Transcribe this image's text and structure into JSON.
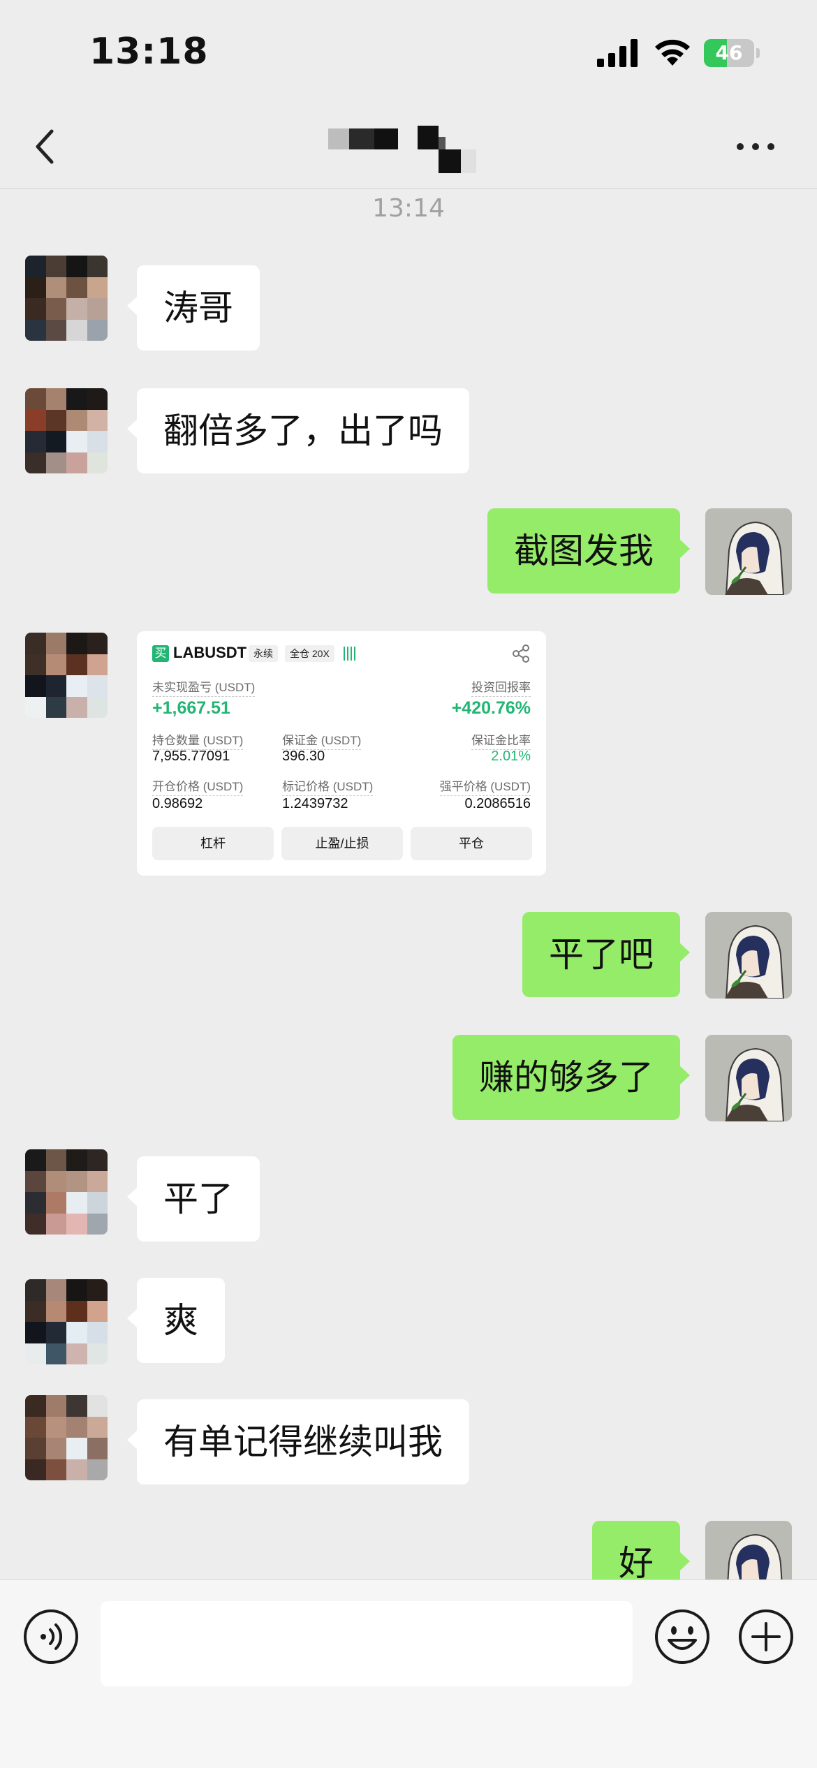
{
  "status_bar": {
    "time": "13:18",
    "battery_level": "46",
    "battery_fraction": 0.46,
    "battery_color": "#34c759"
  },
  "nav": {
    "back_icon": "chevron-left-icon",
    "more_icon": "ellipsis-icon"
  },
  "conversation": {
    "timestamp": "13:14",
    "messages": [
      {
        "from": "contact",
        "text": "涛哥"
      },
      {
        "from": "contact",
        "text": "翻倍多了，出了吗"
      },
      {
        "from": "me",
        "text": "截图发我"
      },
      {
        "from": "contact",
        "type": "image",
        "text": "trading-screenshot"
      },
      {
        "from": "me",
        "text": "平了吧"
      },
      {
        "from": "me",
        "text": "赚的够多了"
      },
      {
        "from": "contact",
        "text": "平了"
      },
      {
        "from": "contact",
        "text": "爽"
      },
      {
        "from": "contact",
        "text": "有单记得继续叫我"
      },
      {
        "from": "me",
        "text": "好"
      }
    ]
  },
  "trade_card": {
    "side_tag": "买",
    "symbol": "LABUSDT",
    "contract_type": "永续",
    "margin_mode": "全仓 20X",
    "unrealized_pnl_label": "未实现盈亏 (USDT)",
    "unrealized_pnl": "+1,667.51",
    "roi_label": "投资回报率",
    "roi": "+420.76%",
    "position_size_label": "持仓数量 (USDT)",
    "position_size": "7,955.77091",
    "margin_label": "保证金 (USDT)",
    "margin": "396.30",
    "margin_ratio_label": "保证金比率",
    "margin_ratio": "2.01%",
    "entry_price_label": "开仓价格 (USDT)",
    "entry_price": "0.98692",
    "mark_price_label": "标记价格 (USDT)",
    "mark_price": "1.2439732",
    "liq_price_label": "强平价格 (USDT)",
    "liq_price": "0.2086516",
    "buttons": [
      "杠杆",
      "止盈/止损",
      "平仓"
    ],
    "accent_color": "#22b573"
  },
  "input_bar": {
    "voice_icon": "voice-icon",
    "emoji_icon": "emoji-icon",
    "plus_icon": "plus-icon",
    "placeholder": ""
  },
  "colors": {
    "background": "#ededed",
    "incoming_bubble": "#ffffff",
    "outgoing_bubble": "#95ec69"
  }
}
